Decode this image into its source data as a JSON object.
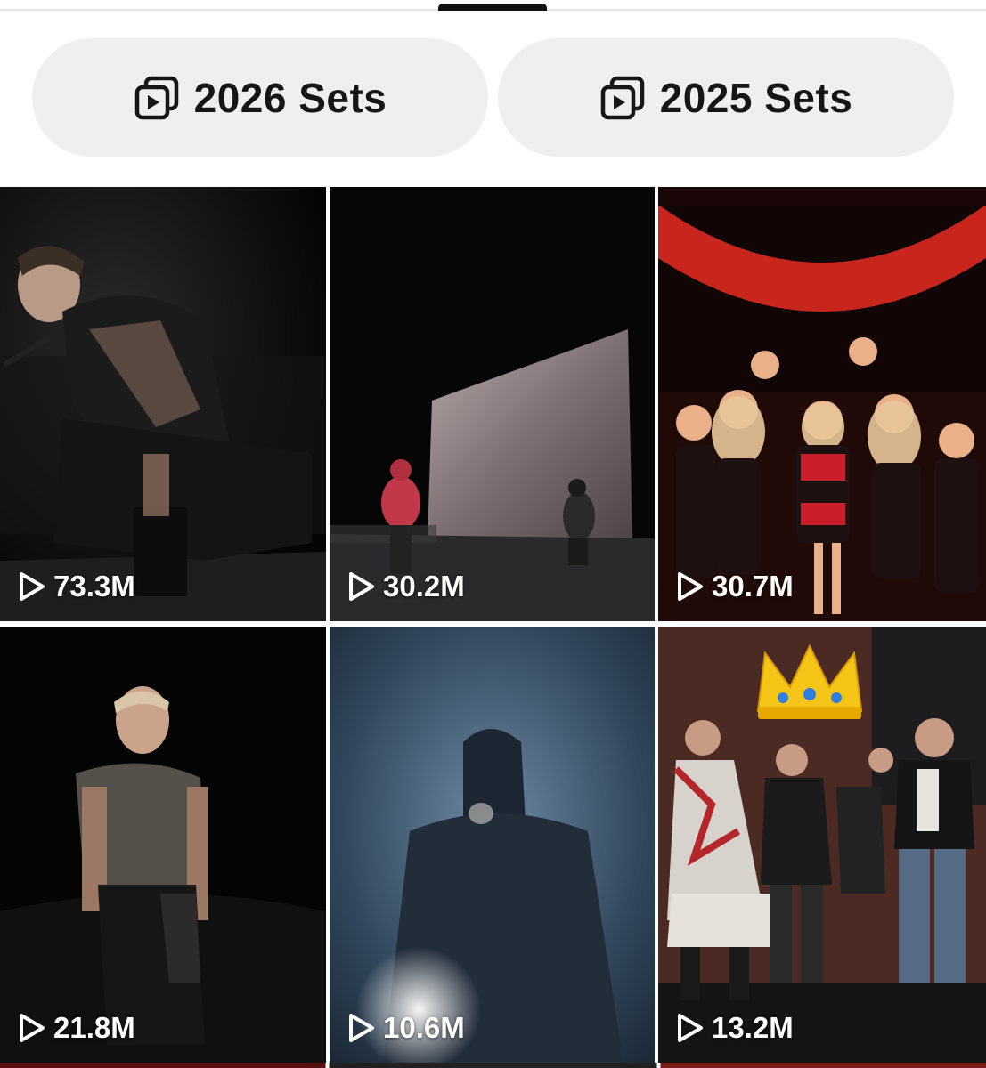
{
  "sets_buttons": [
    {
      "label": "2026 Sets",
      "icon": "playlist-play-icon"
    },
    {
      "label": "2025 Sets",
      "icon": "playlist-play-icon"
    }
  ],
  "videos": [
    {
      "views": "73.3M",
      "scene": "rapper-crouching-with-microphone"
    },
    {
      "views": "30.2M",
      "scene": "two-performers-before-large-screen"
    },
    {
      "views": "30.7M",
      "scene": "group-of-dancers-red-stage"
    },
    {
      "views": "21.8M",
      "scene": "singer-standing-in-dark"
    },
    {
      "views": "10.6M",
      "scene": "hooded-singer-blue-haze"
    },
    {
      "views": "13.2M",
      "scene": "group-on-stage-with-crown-emoji"
    }
  ],
  "colors": {
    "button_bg": "#efefef",
    "text": "#161616",
    "overlay_text": "#ffffff"
  }
}
